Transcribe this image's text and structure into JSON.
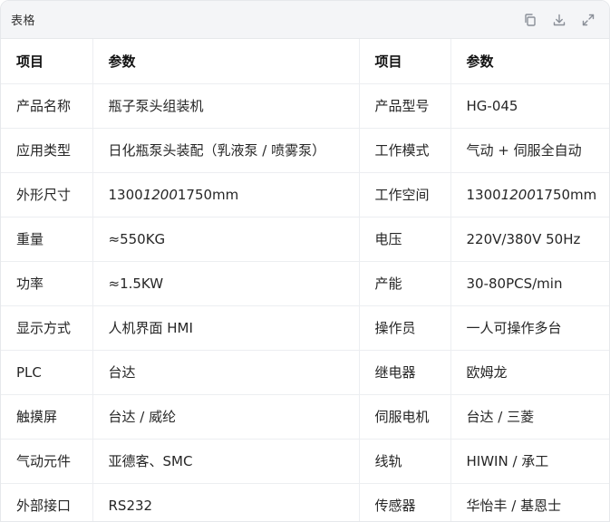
{
  "header": {
    "title": "表格",
    "icons": [
      "copy-icon",
      "download-icon",
      "expand-icon"
    ]
  },
  "table": {
    "headers": [
      "项目",
      "参数",
      "项目",
      "参数"
    ],
    "rows": [
      [
        "产品名称",
        "瓶子泵头组装机",
        "产品型号",
        "HG-045"
      ],
      [
        "应用类型",
        "日化瓶泵头装配（乳液泵 / 喷雾泵）",
        "工作模式",
        "气动 + 伺服全自动"
      ],
      [
        "外形尺寸",
        "1300",
        "工作空间",
        "1300"
      ],
      [
        "重量",
        "≈550KG",
        "电压",
        "220V/380V 50Hz"
      ],
      [
        "功率",
        "≈1.5KW",
        "产能",
        "30-80PCS/min"
      ],
      [
        "显示方式",
        "人机界面 HMI",
        "操作员",
        "一人可操作多台"
      ],
      [
        "PLC",
        "台达",
        "继电器",
        "欧姆龙"
      ],
      [
        "触摸屏",
        "台达 / 威纶",
        "伺服电机",
        "台达 / 三菱"
      ],
      [
        "气动元件",
        "亚德客、SMC",
        "线轨",
        "HIWIN / 承工"
      ],
      [
        "外部接口",
        "RS232",
        "传感器",
        "华怡丰 / 基恩士"
      ]
    ],
    "dims_1": {
      "a": "1300",
      "b": "1200",
      "c": "1750mm"
    },
    "dims_2": {
      "a": "1300",
      "b": "1200",
      "c": "1750mm"
    }
  }
}
